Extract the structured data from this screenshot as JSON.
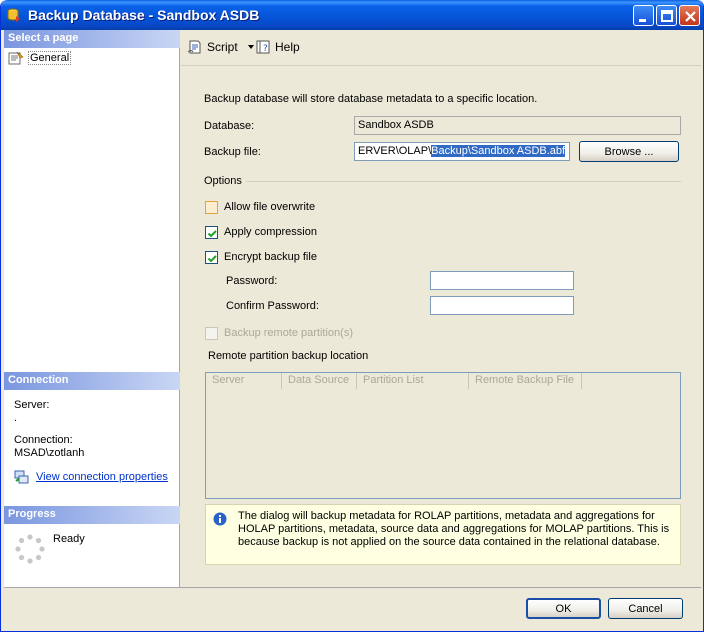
{
  "window": {
    "title": "Backup Database - Sandbox ASDB"
  },
  "left": {
    "select_page_header": "Select a page",
    "nav_general": "General",
    "connection_header": "Connection",
    "server_label": "Server:",
    "server_value": ".",
    "connection_label": "Connection:",
    "connection_value": "MSAD\\zotlanh",
    "view_connection_link": "View connection properties",
    "progress_header": "Progress",
    "progress_status": "Ready"
  },
  "toolbar": {
    "script_label": "Script",
    "help_label": "Help"
  },
  "main": {
    "description": "Backup database will store database metadata to a specific location.",
    "database_label": "Database:",
    "database_value": "Sandbox ASDB",
    "backup_file_label": "Backup file:",
    "backup_file_prefix": "ERVER\\OLAP\\",
    "backup_file_selected": "Backup\\Sandbox ASDB.abf",
    "browse_label": "Browse ...",
    "options_label": "Options",
    "allow_overwrite_label": "Allow file overwrite",
    "allow_overwrite_checked": false,
    "apply_compression_label": "Apply compression",
    "apply_compression_checked": true,
    "encrypt_label": "Encrypt backup file",
    "encrypt_checked": true,
    "password_label": "Password:",
    "password_value": "",
    "confirm_password_label": "Confirm Password:",
    "confirm_password_value": "",
    "remote_partitions_label": "Backup remote partition(s)",
    "remote_partitions_checked": false,
    "remote_location_label": "Remote partition backup location",
    "grid_columns": [
      "Server",
      "Data Source",
      "Partition List",
      "Remote Backup File"
    ],
    "info_text": "The dialog will backup metadata for ROLAP partitions, metadata and aggregations for HOLAP partitions, metadata, source data and aggregations for MOLAP partitions. This is because backup is not applied on the source data contained in the relational database."
  },
  "buttons": {
    "ok_label": "OK",
    "cancel_label": "Cancel"
  },
  "colors": {
    "titlebar": "#0553d6",
    "pane_header": "#7a96df",
    "link": "#0033cc",
    "selection": "#316ac5",
    "info_background": "#ffffe1"
  },
  "icons": {
    "title": "database-backup-icon",
    "general": "general-page-icon",
    "script": "script-icon",
    "help": "help-icon",
    "connection": "connection-properties-icon",
    "progress": "progress-spinner-icon",
    "info": "info-icon"
  }
}
